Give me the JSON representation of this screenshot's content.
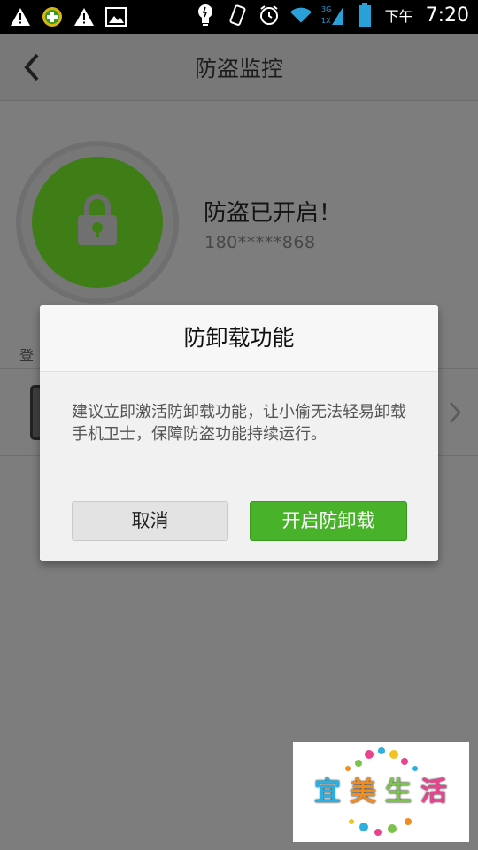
{
  "status_bar": {
    "left_icons": [
      "warning-icon",
      "plus-circle-icon",
      "warning-icon",
      "image-icon"
    ],
    "right_icons": [
      "lightbulb-icon",
      "vibrate-icon",
      "alarm-icon",
      "wifi-icon",
      "network-3g-icon",
      "battery-icon"
    ],
    "ampm": "下午",
    "time": "7:20"
  },
  "header": {
    "title": "防盗监控"
  },
  "status": {
    "title": "防盗已开启！",
    "phone": "180*****868"
  },
  "section": {
    "label": "登"
  },
  "dialog": {
    "title": "防卸载功能",
    "message": "建议立即激活防卸载功能，让小偷无法轻易卸载手机卫士，保障防盗功能持续运行。",
    "cancel_label": "取消",
    "confirm_label": "开启防卸载"
  },
  "watermark": {
    "chars": [
      "宜",
      "美",
      "生",
      "活"
    ],
    "colors": [
      "#2bb0e0",
      "#f28c1e",
      "#7cc34b",
      "#e9428f"
    ]
  }
}
